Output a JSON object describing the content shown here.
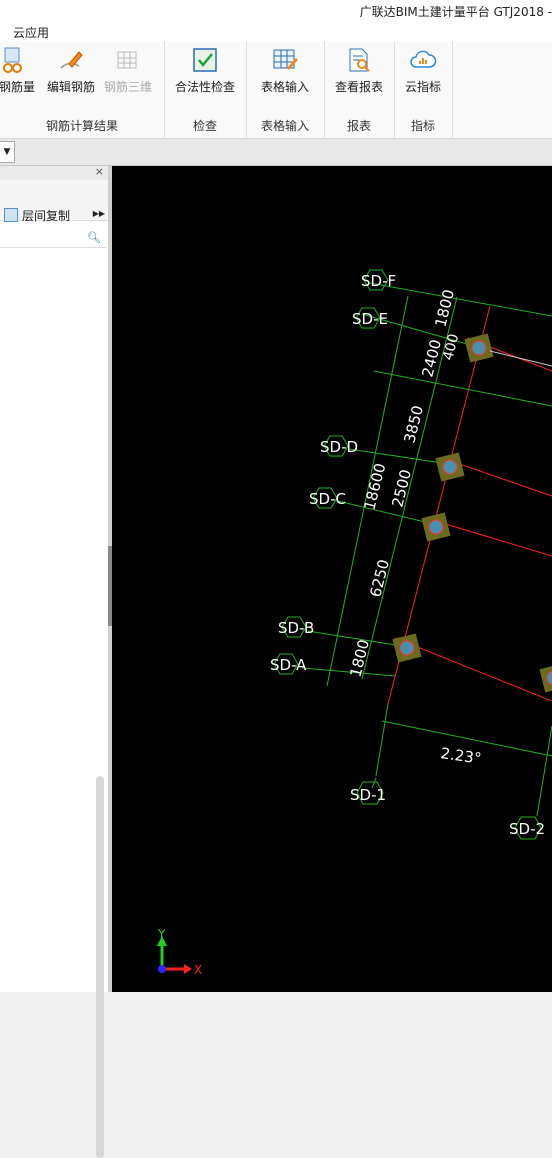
{
  "window": {
    "title": "广联达BIM土建计量平台 GTJ2018 -"
  },
  "menu": {
    "cloud_app": "云应用"
  },
  "ribbon": {
    "groups": [
      {
        "title": "钢筋计算结果",
        "buttons": [
          "钢筋量",
          "编辑钢筋",
          "钢筋三维"
        ]
      },
      {
        "title": "检查",
        "buttons": [
          "合法性检查"
        ]
      },
      {
        "title": "表格输入",
        "buttons": [
          "表格输入"
        ]
      },
      {
        "title": "报表",
        "buttons": [
          "查看报表"
        ]
      },
      {
        "title": "指标",
        "buttons": [
          "云指标"
        ]
      }
    ]
  },
  "left_panel": {
    "close": "×",
    "floor_copy": "层间复制"
  },
  "drawing": {
    "axes_letters": [
      "SD-F",
      "SD-E",
      "SD-D",
      "SD-C",
      "SD-B",
      "SD-A"
    ],
    "axes_numbers": [
      "SD-1",
      "SD-2"
    ],
    "dims": {
      "d1800_top": "1800",
      "d400": "400",
      "d2400": "2400",
      "d3850": "3850",
      "d18600": "18600",
      "d2500": "2500",
      "d6250": "6250",
      "d1800_bot": "1800"
    },
    "angle": "2.23°",
    "ucs": {
      "x": "X",
      "y": "Y"
    }
  },
  "colors": {
    "grid_line": "#ff2020",
    "dim_line": "#22b022",
    "column": "#6b6a1e",
    "axis_x": "#ff2020",
    "axis_y": "#20d020",
    "axis_origin": "#2a2aff"
  }
}
